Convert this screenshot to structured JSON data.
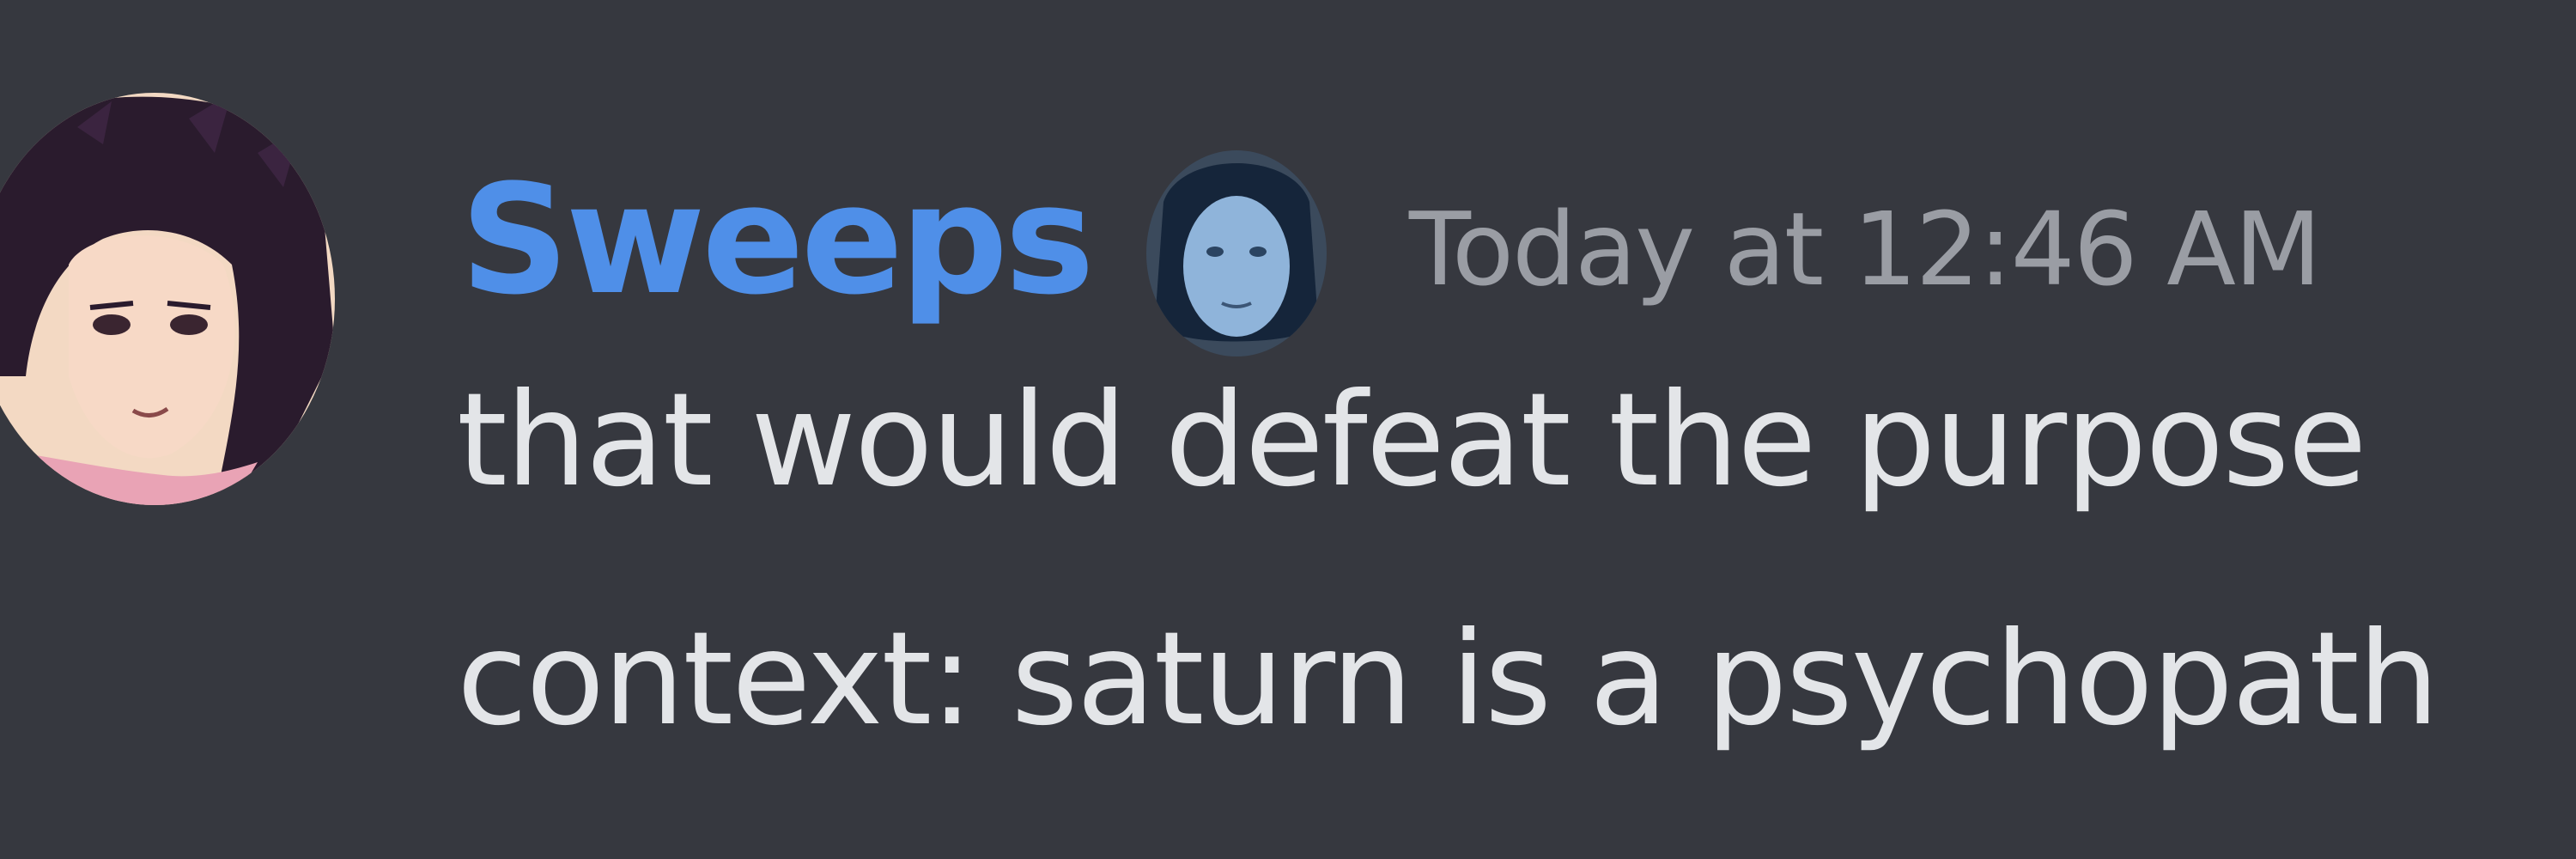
{
  "message": {
    "username": "Sweeps",
    "timestamp": "Today at 12:46 AM",
    "lines": [
      "that would defeat the purpose",
      "context: saturn is a psychopath"
    ]
  },
  "colors": {
    "background": "#36383f",
    "username": "#4f8fe8",
    "timestamp": "#9a9da4",
    "message_text": "#e3e5e8"
  },
  "icons": {
    "avatar": "anime-character-avatar",
    "role_icon": "blue-face-role-icon"
  }
}
